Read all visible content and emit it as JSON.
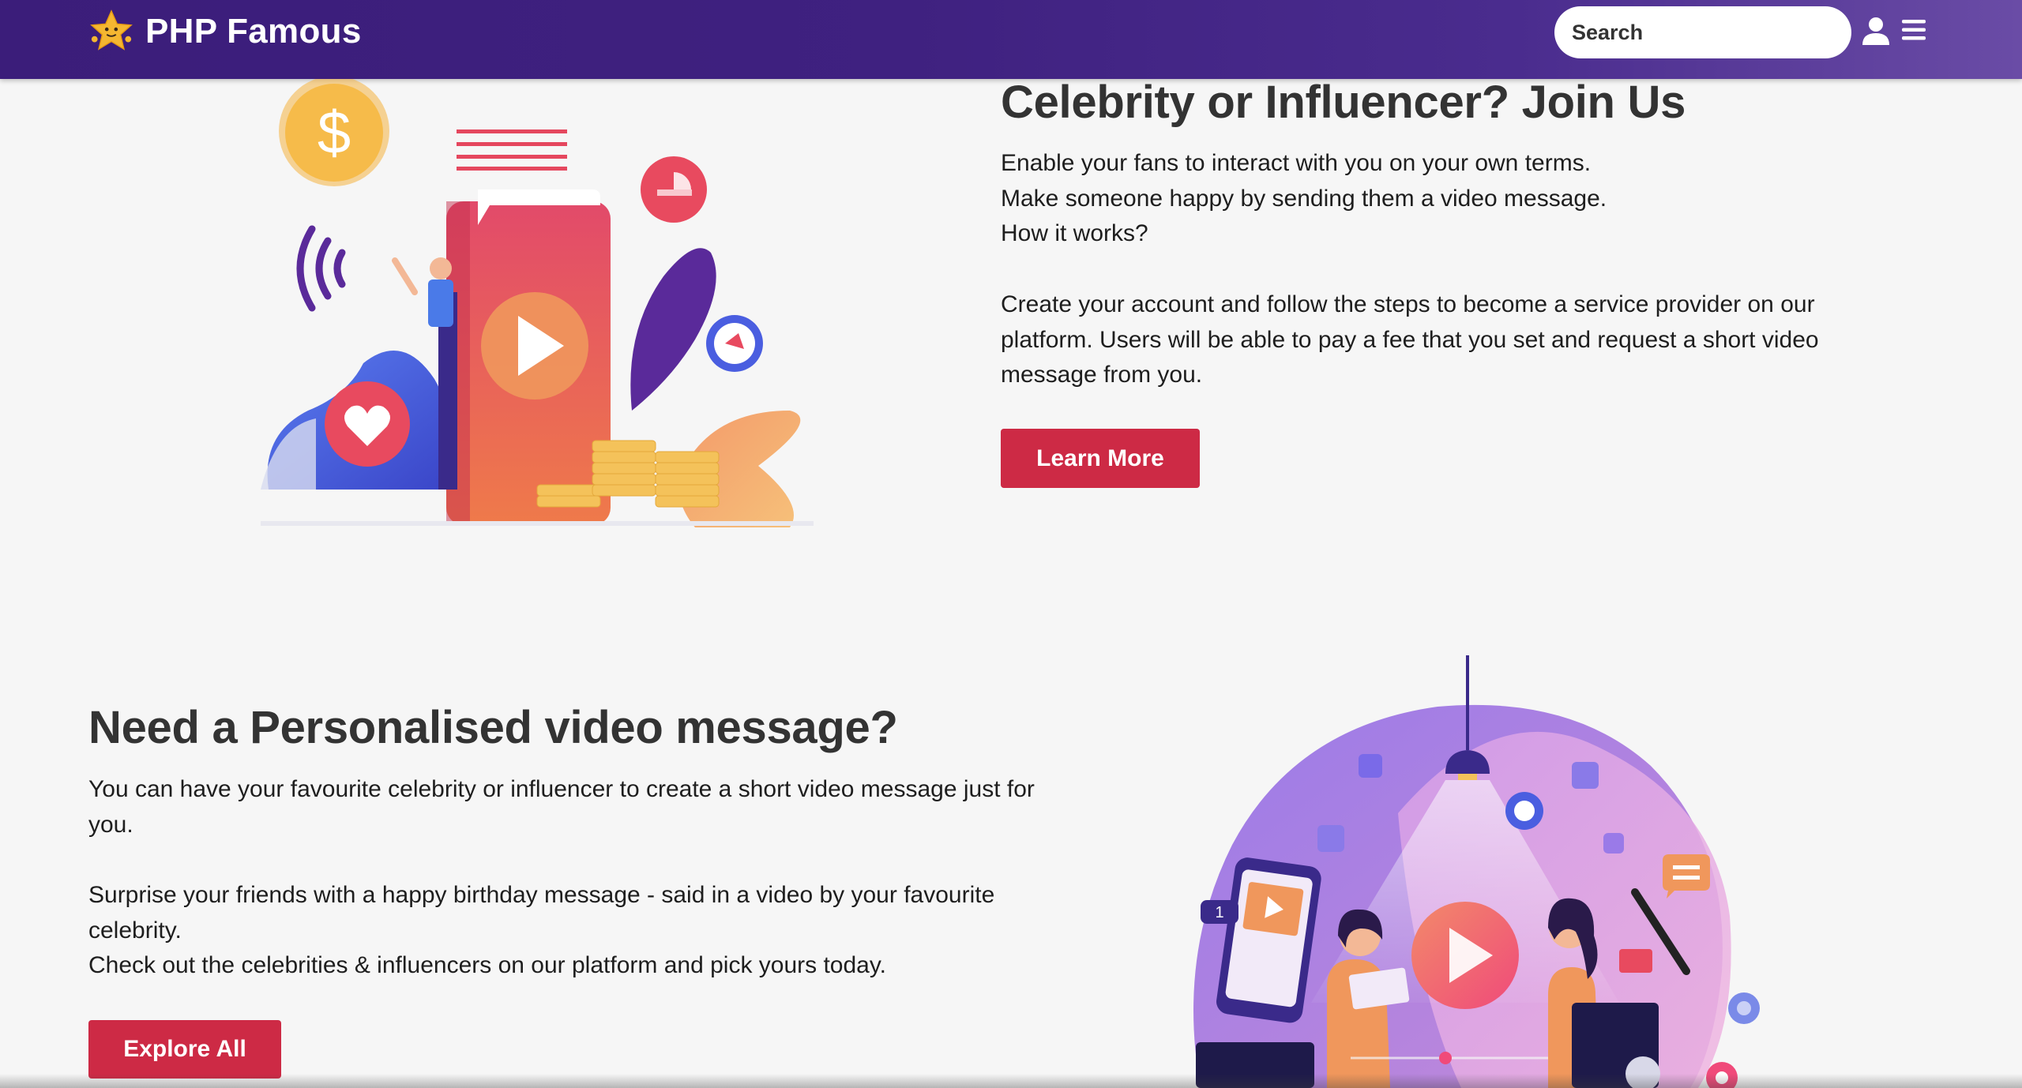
{
  "navbar": {
    "brand_name": "PHP Famous",
    "logo_icon": "star-mascot-icon",
    "search_placeholder": "Search",
    "search_icon": "search-icon",
    "user_icon": "user-icon",
    "menu_icon": "hamburger-menu-icon",
    "background_colors": [
      "#3b1d7a",
      "#6a4ca6"
    ]
  },
  "join_section": {
    "title": "Celebrity or Influencer? Join Us",
    "lines": [
      "Enable your fans to interact with you on your own terms.",
      "Make someone happy by sending them a video message.",
      "How it works?"
    ],
    "description": "Create your account and follow the steps to become a service provider on our platform. Users will be able to pay a fee that you set and request a short video message from you.",
    "button_label": "Learn More",
    "illustration": "influencer-phone-video-illustration"
  },
  "need_section": {
    "title": "Need a Personalised video message?",
    "intro": "You can have your favourite celebrity or influencer to create a short video message just for you.",
    "lines": [
      "Surprise your friends with a happy birthday message - said in a video by your favourite celebrity.",
      "Check out the celebrities & influencers on our platform and pick yours today."
    ],
    "button_label": "Explore All",
    "illustration": "video-message-women-illustration"
  },
  "colors": {
    "accent_button": "#cd2a45",
    "heading": "#333333",
    "page_background": "#f6f6f6"
  }
}
